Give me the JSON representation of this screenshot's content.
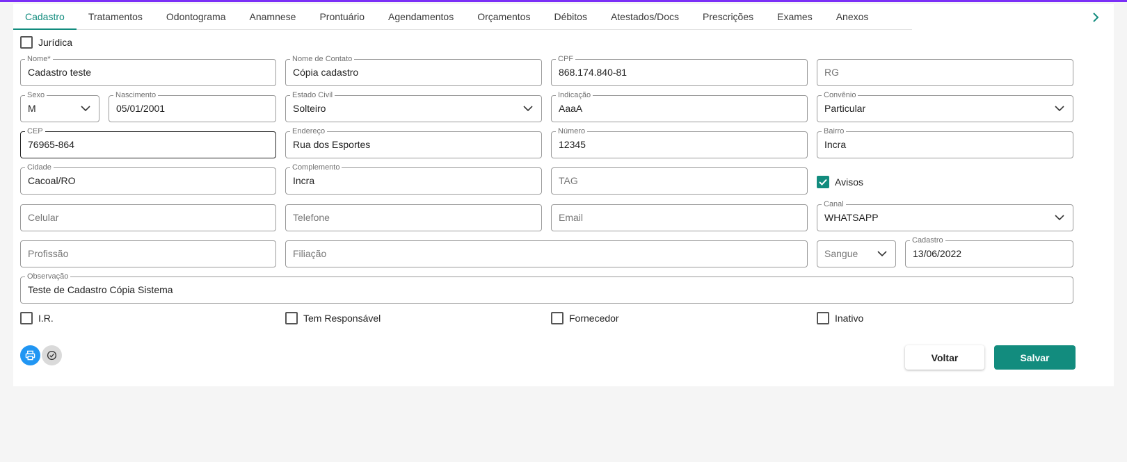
{
  "colors": {
    "accent": "#128c7e",
    "print_button": "#2196f3",
    "top_bar": "#7b2ff7"
  },
  "tabs": [
    {
      "label": "Cadastro",
      "active": true
    },
    {
      "label": "Tratamentos"
    },
    {
      "label": "Odontograma"
    },
    {
      "label": "Anamnese"
    },
    {
      "label": "Prontuário"
    },
    {
      "label": "Agendamentos"
    },
    {
      "label": "Orçamentos"
    },
    {
      "label": "Débitos"
    },
    {
      "label": "Atestados/Docs"
    },
    {
      "label": "Prescrições"
    },
    {
      "label": "Exames"
    },
    {
      "label": "Anexos"
    }
  ],
  "tab_next_icon": "chevron-right-icon",
  "juridica": {
    "label": "Jurídica",
    "checked": false
  },
  "fields": {
    "nome": {
      "label": "Nome*",
      "value": "Cadastro teste"
    },
    "nome_contato": {
      "label": "Nome de Contato",
      "value": "Cópia cadastro"
    },
    "cpf": {
      "label": "CPF",
      "value": "868.174.840-81"
    },
    "rg": {
      "placeholder": "RG"
    },
    "sexo": {
      "label": "Sexo",
      "value": "M"
    },
    "nascimento": {
      "label": "Nascimento",
      "value": "05/01/2001"
    },
    "estado_civil": {
      "label": "Estado Civil",
      "value": "Solteiro"
    },
    "indicacao": {
      "label": "Indicação",
      "value": "AaaA"
    },
    "convenio": {
      "label": "Convênio",
      "value": "Particular"
    },
    "cep": {
      "label": "CEP",
      "value": "76965-864"
    },
    "endereco": {
      "label": "Endereço",
      "value": "Rua dos Esportes"
    },
    "numero": {
      "label": "Número",
      "value": "12345"
    },
    "bairro": {
      "label": "Bairro",
      "value": "Incra"
    },
    "cidade": {
      "label": "Cidade",
      "value": "Cacoal/RO"
    },
    "complemento": {
      "label": "Complemento",
      "value": "Incra"
    },
    "tag": {
      "placeholder": "TAG"
    },
    "celular": {
      "placeholder": "Celular"
    },
    "telefone": {
      "placeholder": "Telefone"
    },
    "email": {
      "placeholder": "Email"
    },
    "canal": {
      "label": "Canal",
      "value": "WHATSAPP"
    },
    "profissao": {
      "placeholder": "Profissão"
    },
    "filiacao": {
      "placeholder": "Filiação"
    },
    "sangue": {
      "placeholder": "Sangue"
    },
    "cadastro": {
      "label": "Cadastro",
      "value": "13/06/2022"
    },
    "observacao": {
      "label": "Observação",
      "value": "Teste de Cadastro Cópia Sistema"
    }
  },
  "checkboxes": {
    "avisos": {
      "label": "Avisos",
      "checked": true
    },
    "ir": {
      "label": "I.R.",
      "checked": false
    },
    "responsavel": {
      "label": "Tem Responsável",
      "checked": false
    },
    "fornecedor": {
      "label": "Fornecedor",
      "checked": false
    },
    "inativo": {
      "label": "Inativo",
      "checked": false
    }
  },
  "icon_buttons": {
    "print": "printer-icon",
    "check": "check-circle-icon"
  },
  "buttons": {
    "back": "Voltar",
    "save": "Salvar"
  }
}
